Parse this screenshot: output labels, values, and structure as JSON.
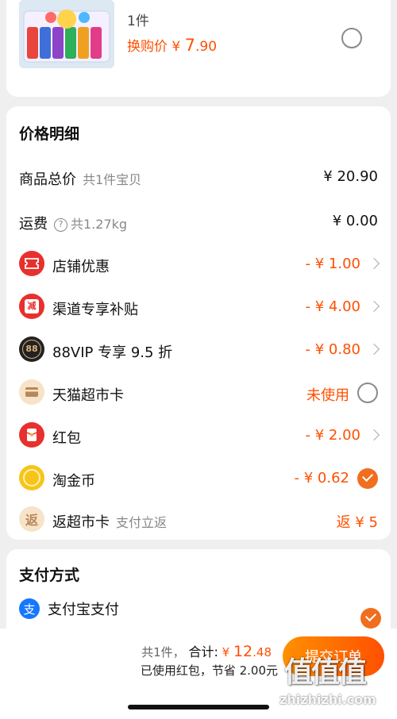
{
  "product": {
    "quantity": "1件",
    "swap_price_label": "换购价",
    "swap_price_currency": "¥",
    "swap_price_int": "7",
    "swap_price_dec": ".90"
  },
  "price_detail": {
    "title": "价格明细",
    "rows": [
      {
        "label": "商品总价",
        "sub": "共1件宝贝",
        "value": "¥ 20.90"
      },
      {
        "label": "运费",
        "help": "?",
        "sub": "共1.27kg",
        "value": "¥ 0.00"
      },
      {
        "label": "店铺优惠",
        "value": "- ¥ 1.00",
        "icon": "ticket-icon"
      },
      {
        "label": "渠道专享补贴",
        "value": "- ¥ 4.00",
        "icon": "subsidy-icon",
        "icon_text": "减"
      },
      {
        "label": "88VIP 专享 9.5 折",
        "value": "- ¥ 0.80",
        "icon": "vip-88-icon",
        "icon_text": "88"
      },
      {
        "label": "天猫超市卡",
        "value": "未使用",
        "icon": "card-icon"
      },
      {
        "label": "红包",
        "value": "- ¥ 2.00",
        "icon": "red-packet-icon"
      },
      {
        "label": "淘金币",
        "value": "- ¥ 0.62",
        "icon": "gold-coin-icon"
      },
      {
        "label": "返超市卡",
        "sub": "支付立返",
        "value": "返 ¥ 5",
        "icon": "return-card-icon",
        "icon_text": "返"
      }
    ]
  },
  "payment": {
    "title": "支付方式",
    "method": "支付宝支付",
    "method_icon_text": "支"
  },
  "bottom": {
    "count": "共1件，",
    "total_label": "合计:",
    "total_currency": "¥ ",
    "total_int": "12",
    "total_dec": ".48",
    "saved": "已使用红包，节省 2.00元",
    "submit": "提交订单"
  },
  "watermark": {
    "logo": "值值值",
    "site": "zhizhizhi.com"
  },
  "colors": {
    "accent": "#ff5000",
    "check": "#f06e1e",
    "alipay": "#1677ff"
  }
}
